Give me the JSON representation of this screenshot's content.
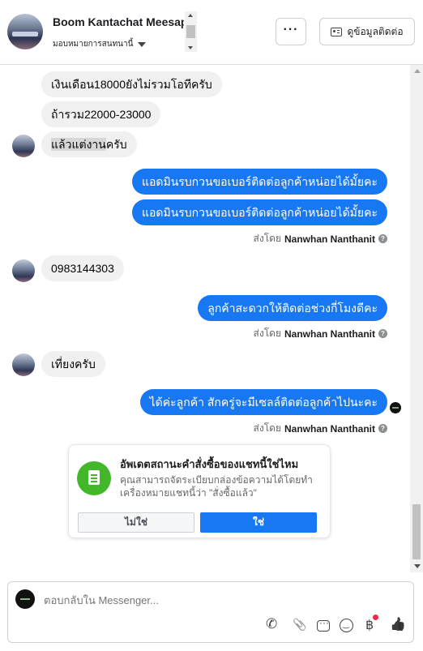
{
  "header": {
    "contact_name": "Boom Kantachat Meesap",
    "assign_label": "มอบหมายการสนทนานี้",
    "more_label": "···",
    "contact_info_label": "ดูข้อมูลติดต่อ"
  },
  "messages": [
    {
      "direction": "in",
      "text": "เงินเดือน18000ยังไม่รวมโอทีครับ"
    },
    {
      "direction": "in",
      "text": "ถ้ารวม22000-23000"
    },
    {
      "direction": "in",
      "text_highlight": "แล้วแต่งาน",
      "text_rest": "ครับ"
    },
    {
      "direction": "out",
      "text": "แอดมินรบกวนขอเบอร์ติดต่อลูกค้าหน่อยได้มั้ยคะ"
    },
    {
      "direction": "out",
      "text": "แอดมินรบกวนขอเบอร์ติดต่อลูกค้าหน่อยได้มั้ยคะ"
    },
    {
      "direction": "in",
      "text": "0983144303"
    },
    {
      "direction": "out",
      "text": "ลูกค้าสะดวกให้ติดต่อช่วงกี่โมงดีคะ"
    },
    {
      "direction": "in",
      "text": "เที่ยงครับ"
    },
    {
      "direction": "out",
      "text": "ได้ค่ะลูกค้า สักครู่จะมีเซลล์ติดต่อลูกค้าไปนะคะ"
    }
  ],
  "sent_by": {
    "prefix": "ส่งโดย",
    "name": "Nanwhan Nanthanit",
    "help": "?"
  },
  "order_card": {
    "title": "อัพเดตสถานะคำสั่งซื้อของแชทนี้ใช่ไหม",
    "description": "คุณสามารถจัดระเบียบกล่องข้อความได้โดยทำเครื่องหมายแชทนี้ว่า \"สั่งซื้อแล้ว\"",
    "no_label": "ไม่ใช่",
    "yes_label": "ใช่"
  },
  "composer": {
    "placeholder": "ตอบกลับใน Messenger..."
  },
  "colors": {
    "outgoing": "#1877f2",
    "incoming": "#f0f0f0",
    "order_icon": "#42b72a",
    "notification_dot": "#f02849"
  },
  "icons": [
    "more-icon",
    "contact-card-icon",
    "help-icon",
    "seen-icon",
    "order-icon",
    "call-icon",
    "attach-icon",
    "saved-reply-icon",
    "emoji-icon",
    "payment-icon",
    "like-icon"
  ]
}
